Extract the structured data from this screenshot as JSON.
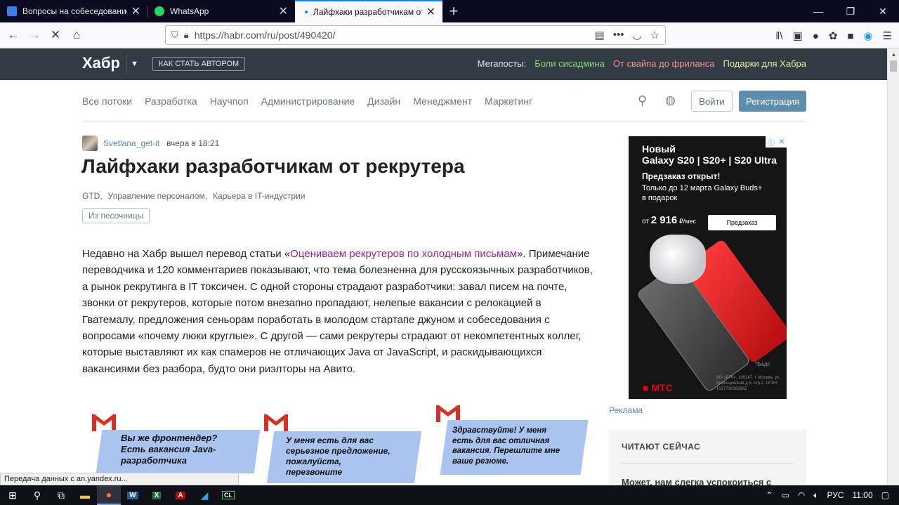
{
  "browser": {
    "tabs": [
      {
        "title": "Вопросы на собеседование -",
        "icon_color": "#3d7ee6"
      },
      {
        "title": "WhatsApp",
        "icon_color": "#25d366"
      },
      {
        "title": "Лайфхаки разработчикам от р",
        "icon_color": "#0a84ff"
      }
    ],
    "new_tab": "+",
    "url": "https://habr.com/ru/post/490420/",
    "status": "Передача данных с an.yandex.ru..."
  },
  "header": {
    "logo": "Хабр",
    "author_button": "КАК СТАТЬ АВТОРОМ",
    "megaposts_label": "Мегапосты:",
    "megaposts": [
      {
        "label": "Боли сисадмина",
        "color": "#84d96b"
      },
      {
        "label": "От свайпа до фриланса",
        "color": "#ff8c8c"
      },
      {
        "label": "Подарки для Хабра",
        "color": "#f2e79a"
      }
    ]
  },
  "flows": [
    "Все потоки",
    "Разработка",
    "Научпоп",
    "Администрирование",
    "Дизайн",
    "Менеджмент",
    "Маркетинг"
  ],
  "auth": {
    "login": "Войти",
    "register": "Регистрация"
  },
  "post": {
    "author": "Svetlana_get-it",
    "time": "вчера в 18:21",
    "title": "Лайфхаки разработчикам от рекрутера",
    "hubs": [
      "GTD,",
      "Управление персоналом,",
      "Карьера в IT-индустрии"
    ],
    "sandbox": "Из песочницы",
    "body_before": "Недавно на Хабр вышел перевод статьи «",
    "body_link": "Оцениваем рекрутеров по холодным письмам",
    "body_after": "». Примечание переводчика и 120 комментариев показывают, что тема болезненна для русскоязычных разработчиков, а рынок рекрутинга в IT токсичен. С одной стороны страдают разработчики: завал писем на почте, звонки от рекрутеров, которые потом внезапно пропадают, нелепые вакансии с релокацией в Гватемалу, предложения сеньорам поработать в молодом стартапе джуном и собеседования с вопросами «почему люки круглые». С другой — сами рекрутеры страдают от некомпетентных коллег, которые выставляют их как спамеров не отличающих Java от JavaScript, и раскидывающихся вакансиями без разбора, будто они риэлторы на Авито."
  },
  "illustration": {
    "bubbles": [
      [
        "Вы же фронтендер?",
        "Есть вакансия Java-",
        "разработчика"
      ],
      [
        "У меня есть для вас",
        "серьезное предложение,",
        "пожалуйста,",
        "перезвоните"
      ],
      [
        "Здравствуйте! У меня",
        "есть для вас отличная",
        "вакансия. Перешлите мне",
        "ваше резюме."
      ]
    ]
  },
  "ad": {
    "line1": "Новый",
    "line2": "Galaxy S20 | S20+ | S20 Ultra",
    "line3": "Предзаказ открыт!",
    "line4": "Только до 12 марта Galaxy Buds+",
    "line5": "в подарок",
    "price_prefix": "от",
    "price": "2 916",
    "price_unit": "₽/мес",
    "button": "Предзаказ",
    "brand": "МТС",
    "footnote": "*Бадс",
    "legal": "АО «РТК», 109147, г. Москва, ул. Воронцовская д.5, стр.2, ОГРН 1027739165662",
    "label": "Реклама"
  },
  "reading": {
    "title": "ЧИТАЮТ СЕЙЧАС",
    "first": "Может, нам слегка успокоиться с"
  },
  "taskbar": {
    "lang": "РУС",
    "time": "11:00"
  }
}
